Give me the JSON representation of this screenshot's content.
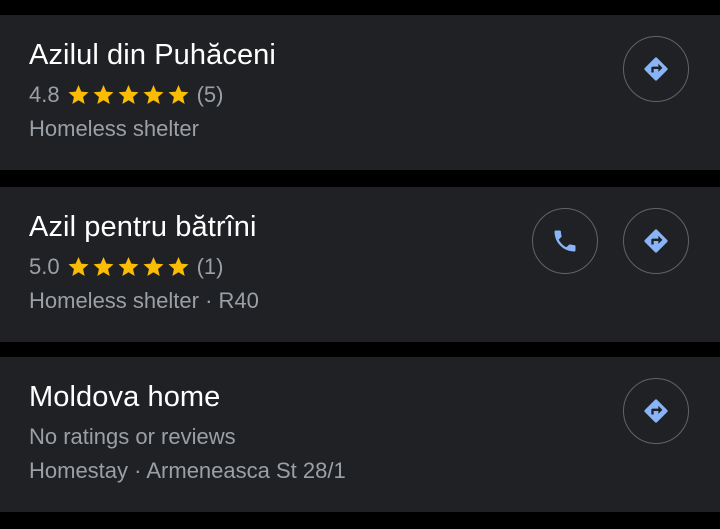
{
  "results": [
    {
      "name": "Azilul din Puhăceni",
      "rating": "4.8",
      "stars": 5,
      "review_count": "(5)",
      "category_line": "Homeless shelter",
      "has_call": false,
      "directions_icon": "directions-icon"
    },
    {
      "name": "Azil pentru bătrîni",
      "rating": "5.0",
      "stars": 5,
      "review_count": "(1)",
      "category_line": "Homeless shelter · R40",
      "has_call": true,
      "call_icon": "phone-icon",
      "directions_icon": "directions-icon"
    },
    {
      "name": "Moldova home",
      "no_ratings": "No ratings or reviews",
      "category_line": "Homestay · Armeneasca St 28/1",
      "has_call": false,
      "directions_icon": "directions-icon"
    }
  ],
  "colors": {
    "background": "#000000",
    "card": "#202124",
    "title": "#ffffff",
    "secondary_text": "#9aa0a6",
    "star": "#fbbc04",
    "icon_blue": "#8ab4f8",
    "button_border": "#5f6368"
  }
}
